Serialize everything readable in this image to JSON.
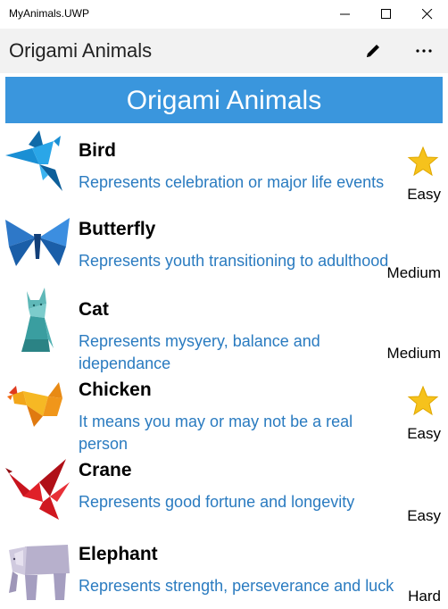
{
  "window": {
    "title": "MyAnimals.UWP"
  },
  "appbar": {
    "title": "Origami Animals"
  },
  "banner": {
    "title": "Origami Animals"
  },
  "animals": [
    {
      "name": "Bird",
      "description": "Represents celebration or major life events",
      "difficulty": "Easy",
      "favorite": true,
      "icon": "origami-bird-icon"
    },
    {
      "name": "Butterfly",
      "description": "Represents youth transitioning to adulthood",
      "difficulty": "Medium",
      "favorite": false,
      "icon": "origami-butterfly-icon"
    },
    {
      "name": "Cat",
      "description": "Represents mysyery, balance and idependance",
      "difficulty": "Medium",
      "favorite": false,
      "icon": "origami-cat-icon"
    },
    {
      "name": "Chicken",
      "description": "It means you may or may not be a real person",
      "difficulty": "Easy",
      "favorite": true,
      "icon": "origami-chicken-icon"
    },
    {
      "name": "Crane",
      "description": "Represents good fortune and longevity",
      "difficulty": "Easy",
      "favorite": false,
      "icon": "origami-crane-icon"
    },
    {
      "name": "Elephant",
      "description": "Represents strength, perseverance and luck",
      "difficulty": "Hard",
      "favorite": false,
      "icon": "origami-elephant-icon"
    }
  ],
  "colors": {
    "accent": "#3a96dd",
    "description_text": "#2a7bc0",
    "star": "#f6c21c"
  }
}
